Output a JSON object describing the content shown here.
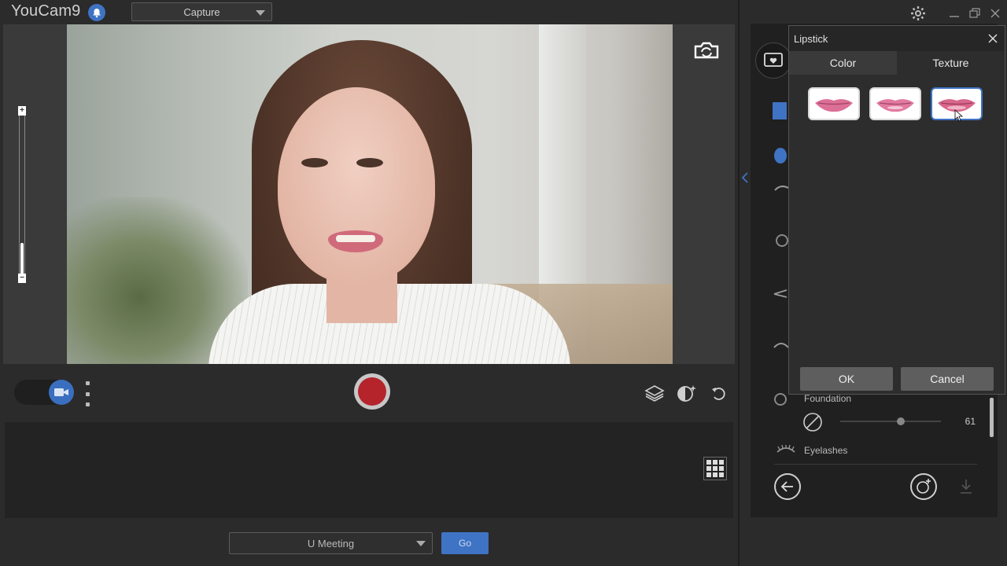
{
  "app": {
    "title": "YouCam9",
    "mode": "Capture"
  },
  "preview": {
    "zoom_plus": "+",
    "zoom_minus": "−",
    "zoom_level": 0.2
  },
  "bottom": {
    "meeting_app": "U Meeting",
    "go_label": "Go"
  },
  "makeup_panel": {
    "items": [
      {
        "label": "Foundation",
        "value": "61"
      },
      {
        "label": "Eyelashes"
      }
    ]
  },
  "dialog": {
    "title": "Lipstick",
    "tabs": [
      "Color",
      "Texture"
    ],
    "active_tab": "Texture",
    "textures": [
      {
        "name": "texture-1",
        "selected": false
      },
      {
        "name": "texture-2",
        "selected": false
      },
      {
        "name": "texture-3",
        "selected": true
      }
    ],
    "ok_label": "OK",
    "cancel_label": "Cancel"
  },
  "colors": {
    "accent": "#3f73c4",
    "record": "#b5242b",
    "lipstick": "#d9668b"
  },
  "icons": [
    "bell-icon",
    "camera-switch-icon",
    "video-camera-icon",
    "more-options-icon",
    "record-button",
    "layers-icon",
    "face-sparkle-icon",
    "undo-icon",
    "grid-icon",
    "settings-icon",
    "minimize-icon",
    "restore-icon",
    "close-icon",
    "back-icon",
    "add-face-icon",
    "download-icon"
  ]
}
